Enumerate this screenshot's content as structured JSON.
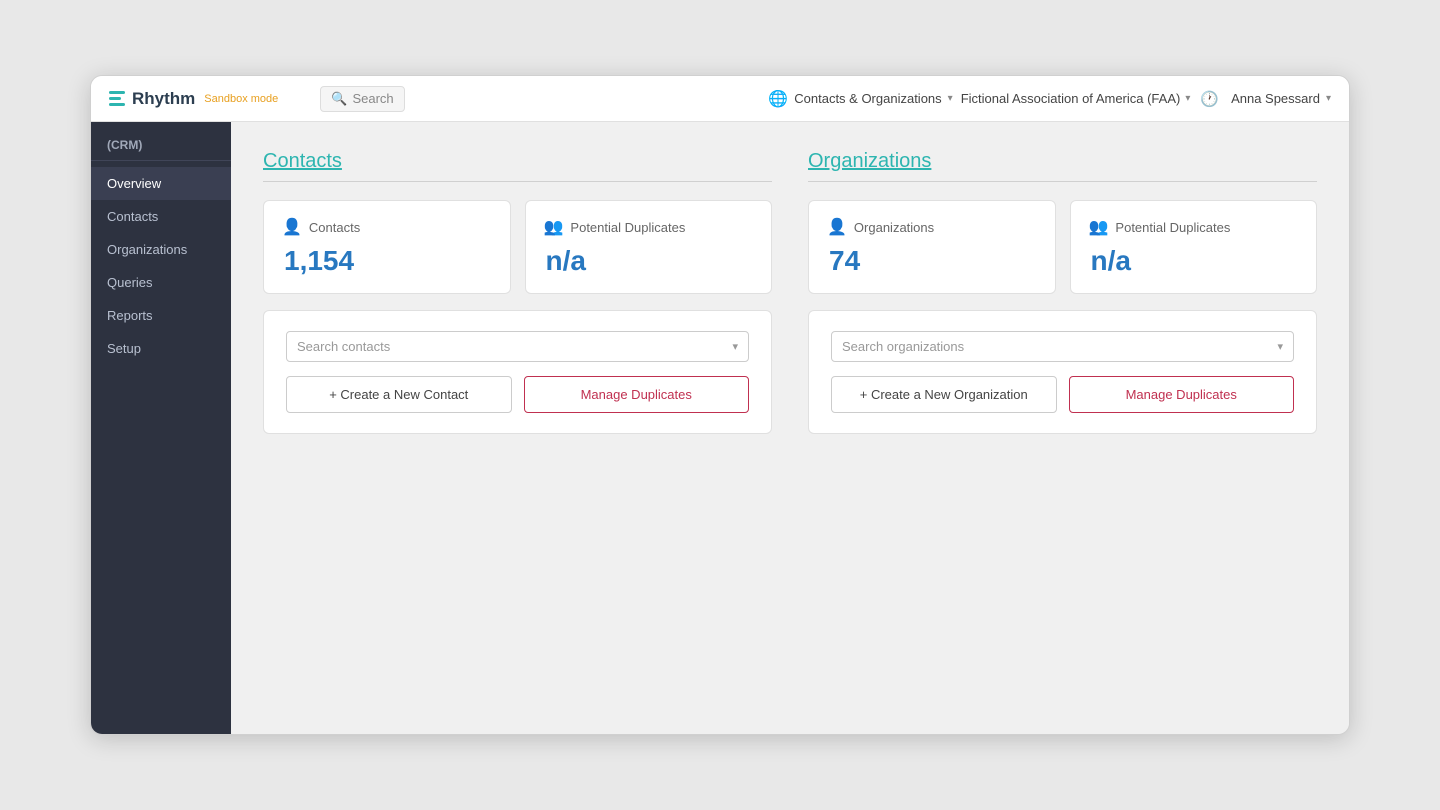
{
  "app": {
    "name": "Rhythm",
    "mode": "Sandbox mode",
    "logo_icon": "grid-icon"
  },
  "topbar": {
    "search_label": "Search",
    "nav_label": "Contacts & Organizations",
    "org_label": "Fictional Association of America (FAA)",
    "user_label": "Anna Spessard",
    "clock_icon": "clock-icon"
  },
  "sidebar": {
    "section_label": "(CRM)",
    "items": [
      {
        "label": "Overview",
        "active": true
      },
      {
        "label": "Contacts",
        "active": false
      },
      {
        "label": "Organizations",
        "active": false
      },
      {
        "label": "Queries",
        "active": false
      },
      {
        "label": "Reports",
        "active": false
      },
      {
        "label": "Setup",
        "active": false
      }
    ]
  },
  "contacts_section": {
    "title": "Contacts",
    "stats": [
      {
        "label": "Contacts",
        "value": "1,154",
        "icon": "contact-icon",
        "icon_type": "normal"
      },
      {
        "label": "Potential Duplicates",
        "value": "n/a",
        "icon": "duplicate-contact-icon",
        "icon_type": "dup"
      }
    ],
    "search_placeholder": "Search contacts",
    "create_button": "+ Create a New Contact",
    "manage_button": "Manage Duplicates"
  },
  "organizations_section": {
    "title": "Organizations",
    "stats": [
      {
        "label": "Organizations",
        "value": "74",
        "icon": "org-icon",
        "icon_type": "normal"
      },
      {
        "label": "Potential Duplicates",
        "value": "n/a",
        "icon": "duplicate-org-icon",
        "icon_type": "dup"
      }
    ],
    "search_placeholder": "Search organizations",
    "create_button": "+ Create a New Organization",
    "manage_button": "Manage Duplicates"
  }
}
